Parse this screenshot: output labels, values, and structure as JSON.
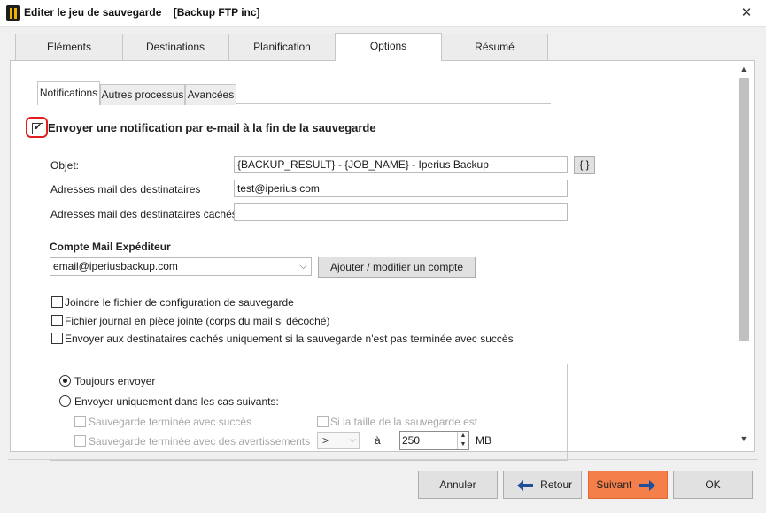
{
  "window": {
    "title": "Editer le jeu de sauvegarde    [Backup FTP inc]",
    "close_glyph": "✕"
  },
  "main_tabs": [
    "Eléments",
    "Destinations",
    "Planification",
    "Options",
    "Résumé"
  ],
  "active_main_tab": "Options",
  "sub_tabs": [
    "Notifications",
    "Autres processus",
    "Avancées"
  ],
  "active_sub_tab": "Notifications",
  "notification": {
    "enable_label": "Envoyer une notification par e-mail à la fin de la sauvegarde",
    "enabled": true,
    "subject_label": "Objet:",
    "subject_value": "{BACKUP_RESULT} - {JOB_NAME} - Iperius Backup",
    "variables_button": "{ }",
    "recipients_label": "Adresses mail des destinataires",
    "recipients_value": "test@iperius.com",
    "bcc_label": "Adresses mail des destinataires cachés",
    "bcc_value": ""
  },
  "sender": {
    "title": "Compte Mail Expéditeur",
    "account": "email@iperiusbackup.com",
    "add_modify_button": "Ajouter / modifier un compte"
  },
  "options": [
    {
      "label": "Joindre le fichier de configuration de sauvegarde",
      "checked": false
    },
    {
      "label": "Fichier journal en pièce jointe (corps du mail si décoché)",
      "checked": false
    },
    {
      "label": "Envoyer aux destinataires cachés uniquement si la sauvegarde n'est pas terminée avec succès",
      "checked": false
    }
  ],
  "send_mode": {
    "always_label": "Toujours envoyer",
    "always_selected": true,
    "conditional_label": "Envoyer uniquement dans les cas suivants:",
    "success_label": "Sauvegarde terminée avec succès",
    "warnings_label": "Sauvegarde terminée avec des avertissements",
    "size_label": "Si la taille de la sauvegarde est",
    "operator": ">",
    "to_label": "à",
    "size_value": "250",
    "unit": "MB"
  },
  "footer": {
    "cancel": "Annuler",
    "back": "Retour",
    "next": "Suivant",
    "ok": "OK"
  },
  "colors": {
    "accent": "#f47f4a",
    "focus_ring": "#e02020",
    "arrow_blue": "#1f4f99"
  },
  "icons": {
    "app": "iperius-logo-icon",
    "close": "close-icon",
    "back": "arrow-left-icon",
    "next": "arrow-right-icon"
  }
}
